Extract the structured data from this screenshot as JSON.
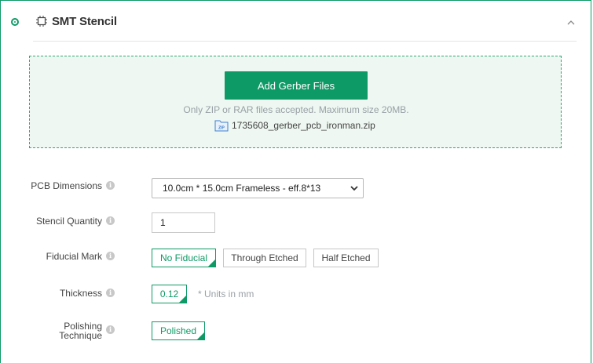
{
  "section": {
    "title": "SMT Stencil"
  },
  "upload": {
    "button_label": "Add Gerber Files",
    "hint": "Only ZIP or RAR files accepted. Maximum size 20MB.",
    "file_icon_text": "ZIP",
    "file_name": "1735608_gerber_pcb_ironman.zip"
  },
  "form": {
    "pcb_dimensions": {
      "label": "PCB Dimensions",
      "selected": "10.0cm * 15.0cm Frameless - eff.8*13"
    },
    "stencil_quantity": {
      "label": "Stencil Quantity",
      "value": "1"
    },
    "fiducial_mark": {
      "label": "Fiducial Mark",
      "options": [
        "No Fiducial",
        "Through Etched",
        "Half Etched"
      ],
      "selected_index": 0
    },
    "thickness": {
      "label": "Thickness",
      "selected": "0.12",
      "units_note": "* Units in mm"
    },
    "polishing_technique": {
      "label_line1": "Polishing",
      "label_line2": "Technique",
      "selected": "Polished"
    }
  },
  "colors": {
    "accent": "#0e9a66",
    "upload_bg": "#eef7f1",
    "muted_text": "#9aa0a6"
  },
  "icons": {
    "status": "radio-dot-icon",
    "section": "chip-icon",
    "collapse": "chevron-up-icon",
    "info": "info-icon",
    "file": "zip-file-icon",
    "dropdown": "chevron-down-icon"
  }
}
